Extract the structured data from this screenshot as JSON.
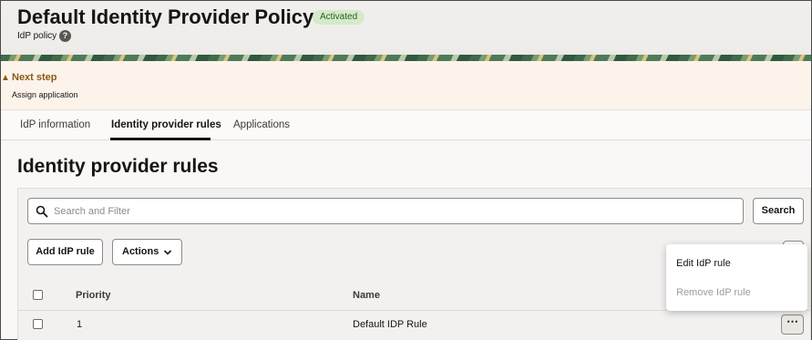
{
  "header": {
    "title": "Default Identity Provider Policy",
    "status_badge": "Activated",
    "subtitle": "IdP policy",
    "help_glyph": "?"
  },
  "banner": {
    "icon": "warning-icon",
    "title": "Next step",
    "text": "Assign application"
  },
  "tabs": [
    {
      "label": "IdP information",
      "active": false
    },
    {
      "label": "Identity provider rules",
      "active": true
    },
    {
      "label": "Applications",
      "active": false
    }
  ],
  "section": {
    "title": "Identity provider rules"
  },
  "toolbar": {
    "search_placeholder": "Search and Filter",
    "search_label": "Search",
    "add_label": "Add IdP rule",
    "actions_label": "Actions"
  },
  "table": {
    "columns": [
      "Priority",
      "Name"
    ],
    "rows": [
      {
        "priority": "1",
        "name": "Default IDP Rule"
      }
    ]
  },
  "row_menu": {
    "items": [
      {
        "label": "Edit IdP rule",
        "enabled": true
      },
      {
        "label": "Remove IdP rule",
        "enabled": false
      }
    ]
  },
  "colors": {
    "badge_bg": "#d3ebc8",
    "banner_bg": "#fcf3ea",
    "banner_accent": "#8a5a16"
  }
}
